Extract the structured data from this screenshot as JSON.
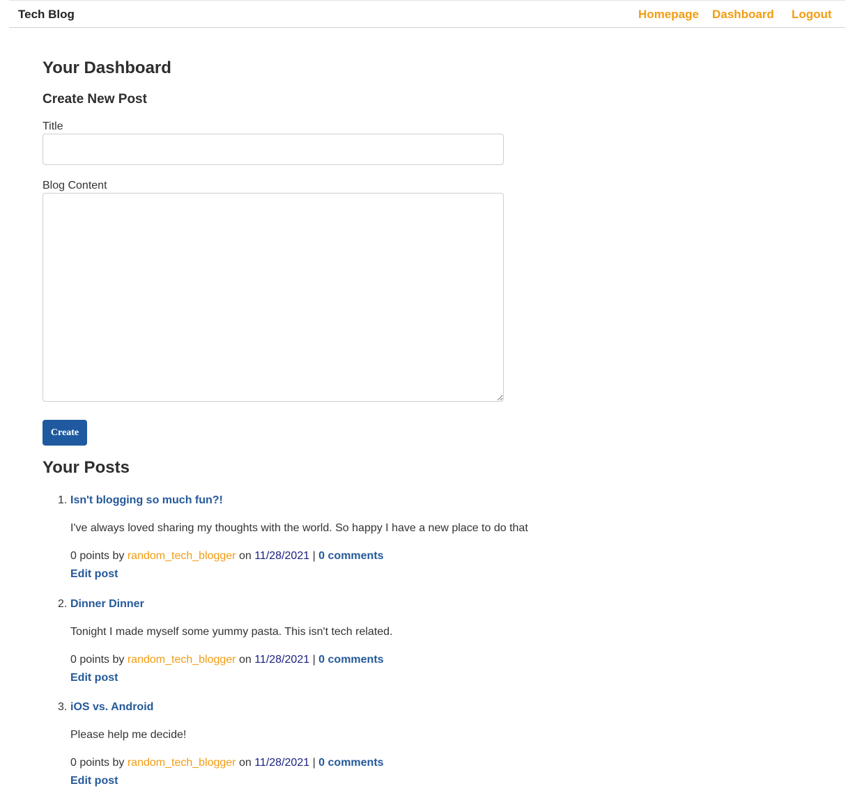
{
  "header": {
    "brand": "Tech Blog",
    "nav": {
      "homepage": "Homepage",
      "dashboard": "Dashboard",
      "logout": "Logout"
    }
  },
  "dashboard": {
    "title": "Your Dashboard",
    "create_heading": "Create New Post",
    "title_label": "Title",
    "title_value": "",
    "content_label": "Blog Content",
    "content_value": "",
    "create_button": "Create"
  },
  "posts_heading": "Your Posts",
  "posts": [
    {
      "number": "1.",
      "title": "Isn't blogging so much fun?!",
      "body": "I've always loved sharing my thoughts with the world. So happy I have a new place to do that",
      "points_text": "0 points by",
      "author": "random_tech_blogger",
      "on_text": "on",
      "date": "11/28/2021",
      "separator": "|",
      "comments": "0 comments",
      "edit_label": "Edit post"
    },
    {
      "number": "2.",
      "title": "Dinner Dinner",
      "body": "Tonight I made myself some yummy pasta. This isn't tech related.",
      "points_text": "0 points by",
      "author": "random_tech_blogger",
      "on_text": "on",
      "date": "11/28/2021",
      "separator": "|",
      "comments": "0 comments",
      "edit_label": "Edit post"
    },
    {
      "number": "3.",
      "title": "iOS vs. Android",
      "body": "Please help me decide!",
      "points_text": "0 points by",
      "author": "random_tech_blogger",
      "on_text": "on",
      "date": "11/28/2021",
      "separator": "|",
      "comments": "0 comments",
      "edit_label": "Edit post"
    }
  ],
  "colors": {
    "nav_link": "#f39c12",
    "link_blue": "#24599a",
    "button_blue": "#1f5aa0",
    "date_navy": "#1a237e"
  }
}
